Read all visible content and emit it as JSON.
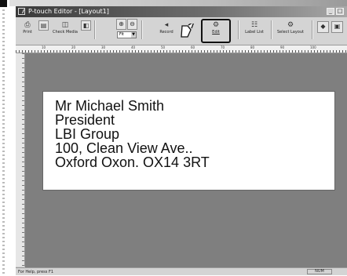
{
  "window": {
    "title": "P-touch Editor - [Layout1]",
    "controls": {
      "minimize": "_",
      "maximize": "□"
    }
  },
  "toolbar": {
    "tools": [
      {
        "id": "print",
        "label": "Print",
        "icon": "printer-icon"
      },
      {
        "id": "check-media",
        "label": "Check Media",
        "icon": "media-icon"
      },
      {
        "id": "record",
        "label": "Record",
        "icon": "record-icon"
      },
      {
        "id": "edit",
        "label": "Edit",
        "icon": "edit-icon"
      },
      {
        "id": "label-list",
        "label": "Label List",
        "icon": "label-list-icon"
      },
      {
        "id": "select-layout",
        "label": "Select Layout",
        "icon": "layout-icon"
      }
    ],
    "zoom_value": "Fit"
  },
  "ruler": {
    "marks": [
      "10",
      "20",
      "30",
      "40",
      "50",
      "60",
      "70",
      "80",
      "90",
      "100"
    ]
  },
  "label": {
    "lines": [
      "Mr Michael Smith",
      "President",
      "LBI Group",
      "100, Clean View Ave..",
      "Oxford Oxon. OX14 3RT"
    ]
  },
  "status": {
    "help": "For Help, press F1",
    "num": "NUM"
  },
  "colors": {
    "workspace": "#7f7f7f",
    "title_bar": "#3a3a3a",
    "chrome": "#d4d4d4"
  }
}
